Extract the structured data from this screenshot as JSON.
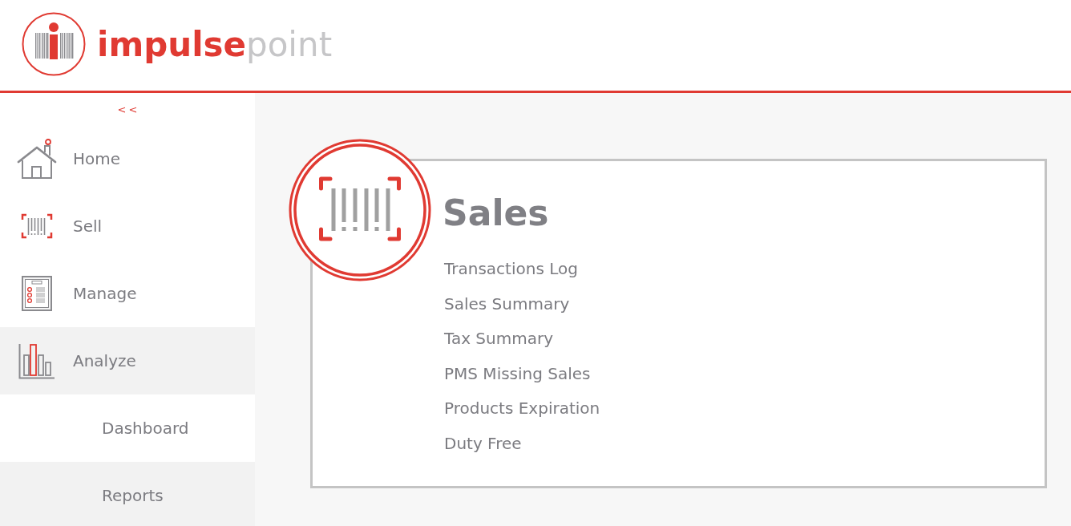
{
  "header": {
    "logo": {
      "bold_part": "impulse",
      "light_part": "point"
    }
  },
  "sidebar": {
    "collapse_button": "<<",
    "items": [
      {
        "label": "Home",
        "selected": false
      },
      {
        "label": "Sell",
        "selected": false
      },
      {
        "label": "Manage",
        "selected": false
      },
      {
        "label": "Analyze",
        "selected": true,
        "children": [
          {
            "label": "Dashboard",
            "selected": false
          },
          {
            "label": "Reports",
            "selected": true
          }
        ]
      }
    ]
  },
  "card": {
    "title": "Sales",
    "links": [
      "Transactions Log",
      "Sales Summary",
      "Tax Summary",
      "PMS Missing Sales",
      "Products Expiration",
      "Duty Free"
    ]
  }
}
